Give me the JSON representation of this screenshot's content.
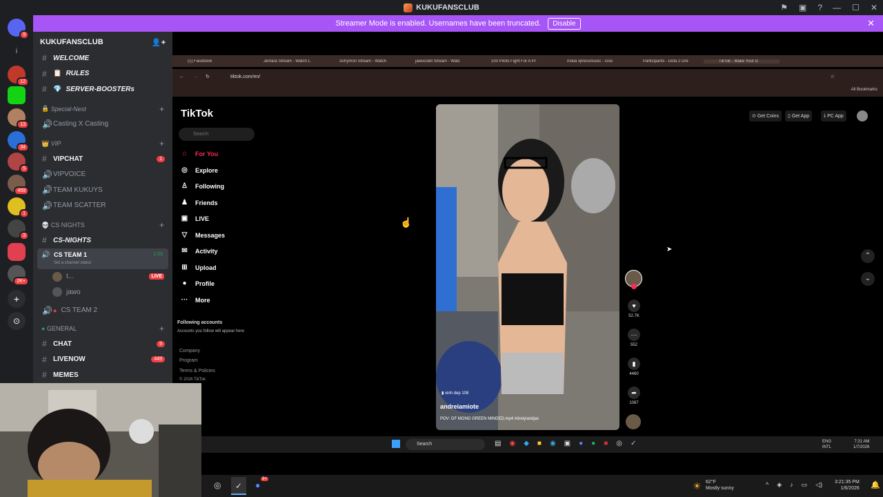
{
  "titlebar": {
    "title": "KUKUFANSCLUB"
  },
  "banner": {
    "text": "Streamer Mode is enabled. Usernames have been truncated.",
    "button": "Disable"
  },
  "rail": {
    "badges": [
      "9",
      "12",
      "13",
      "34",
      "5",
      "459",
      "1",
      "3",
      "2K+"
    ]
  },
  "server": {
    "name": "KUKUFANSCLUB",
    "top_channels": [
      {
        "label": "WELCOME"
      },
      {
        "label": "RULES",
        "emoji": "📋"
      },
      {
        "label": "SERVER-BOOSTERs",
        "emoji": "💎"
      }
    ],
    "special_nest": {
      "category": "Special-Nest",
      "channel": "Casting X Casting"
    },
    "vip": {
      "category": "VIP",
      "channels": [
        {
          "label": "VIPCHAT",
          "badge": "1"
        },
        {
          "label": "VIPVOICE"
        },
        {
          "label": "TEAM KUKUYS"
        },
        {
          "label": "TEAM SCATTER"
        }
      ]
    },
    "cs": {
      "category": "CS NIGHTS",
      "channel": "CS-NIGHTS",
      "voice": "CS TEAM 1",
      "voice_time": "1:03",
      "voice_status": "Set a channel status",
      "users": [
        {
          "name": "t...",
          "live": "LIVE"
        },
        {
          "name": "jawo"
        }
      ],
      "voice2": "CS TEAM 2"
    },
    "general": {
      "category": "GENERAL",
      "channels": [
        {
          "label": "CHAT",
          "badge": "9"
        },
        {
          "label": "LIVENOW",
          "badge": "449"
        },
        {
          "label": "MEMES"
        }
      ]
    }
  },
  "browser": {
    "tabs": [
      "(1) Facebook",
      "JeiVara Stream - Watch L",
      "Achymon Stream - Watch",
      "jawocolet Stream - Watc",
      "100 Pilots Fight For A Pr",
      "nokia xpressmusic - Goo",
      "Participants - Dota 2 Dre",
      "TikTok - Make Your D"
    ],
    "url": "tiktok.com/en/",
    "bookmarks": "All Bookmarks"
  },
  "tiktok": {
    "logo": "TikTok",
    "search_placeholder": "Search",
    "nav": [
      "For You",
      "Explore",
      "Following",
      "Friends",
      "LIVE",
      "Messages",
      "Activity",
      "Upload",
      "Profile",
      "More"
    ],
    "following_title": "Following accounts",
    "following_sub": "Accounts you follow will appear here",
    "footer": [
      "Company",
      "Program",
      "Terms & Policies",
      "© 2026 TikTok"
    ],
    "top_buttons": [
      "Get Coins",
      "Get App",
      "PC App"
    ],
    "video": {
      "tag": "xinh dep 108",
      "author": "andreiamiote",
      "caption": "POV: GF MONG GREEN MINDED.mp4 #dreiyiandjas"
    },
    "actions": {
      "likes": "52.7K",
      "comments": "552",
      "saves": "4460",
      "shares": "1087"
    }
  },
  "inner_taskbar": {
    "search": "Search",
    "lang": "ENG",
    "lang2": "INTL",
    "time": "7:21 AM",
    "date": "1/7/2026"
  },
  "taskbar": {
    "weather_temp": "62°F",
    "weather_desc": "Mostly sunny",
    "time": "3:21:35 PM",
    "date": "1/6/2026",
    "badge": "9+"
  }
}
